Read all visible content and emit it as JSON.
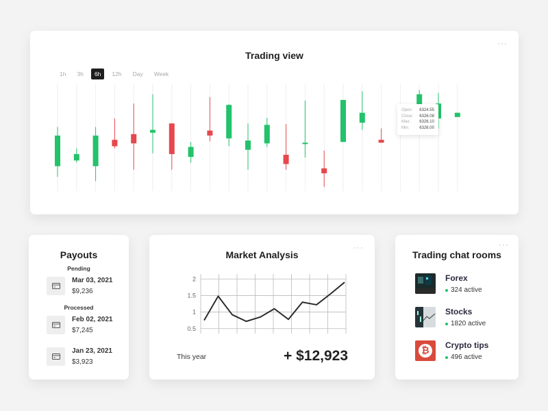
{
  "trading": {
    "title": "Trading view",
    "timeframes": [
      "1h",
      "3h",
      "6h",
      "12h",
      "Day",
      "Week"
    ],
    "active_timeframe": "6h",
    "tooltip": {
      "open_label": "Open:",
      "open": "6324.55",
      "close_label": "Close:",
      "close": "6326.08",
      "max_label": "Max:",
      "max": "6326.10",
      "min_label": "Min:",
      "min": "6326.00"
    },
    "colors": {
      "up": "#23c26b",
      "down": "#e5484d",
      "grid": "#eeeeee"
    },
    "candles": [
      {
        "dir": "up",
        "open": 45,
        "close": 88,
        "high": 100,
        "low": 30
      },
      {
        "dir": "up",
        "open": 53,
        "close": 62,
        "high": 70,
        "low": 50
      },
      {
        "dir": "up",
        "open": 45,
        "close": 88,
        "high": 100,
        "low": 24
      },
      {
        "dir": "down",
        "open": 82,
        "close": 73,
        "high": 112,
        "low": 70
      },
      {
        "dir": "down",
        "open": 90,
        "close": 77,
        "high": 133,
        "low": 40
      },
      {
        "dir": "up",
        "open": 92,
        "close": 96,
        "high": 146,
        "low": 63
      },
      {
        "dir": "down",
        "open": 105,
        "close": 62,
        "high": 105,
        "low": 40
      },
      {
        "dir": "up",
        "open": 58,
        "close": 72,
        "high": 79,
        "low": 50
      },
      {
        "dir": "down",
        "open": 95,
        "close": 88,
        "high": 142,
        "low": 80
      },
      {
        "dir": "up",
        "open": 84,
        "close": 131,
        "high": 132,
        "low": 73
      },
      {
        "dir": "up",
        "open": 68,
        "close": 81,
        "high": 105,
        "low": 40
      },
      {
        "dir": "up",
        "open": 77,
        "close": 103,
        "high": 113,
        "low": 72
      },
      {
        "dir": "down",
        "open": 61,
        "close": 48,
        "high": 104,
        "low": 40
      },
      {
        "dir": "up",
        "open": 76,
        "close": 78,
        "high": 137,
        "low": 57
      },
      {
        "dir": "down",
        "open": 42,
        "close": 35,
        "high": 67,
        "low": 16
      },
      {
        "dir": "up",
        "option": "",
        "open": 79,
        "close": 138,
        "high": 138,
        "low": 79
      },
      {
        "dir": "up",
        "open": 106,
        "close": 120,
        "high": 150,
        "low": 96
      },
      {
        "dir": "down",
        "open": 82,
        "close": 78,
        "high": 98,
        "low": 78
      },
      {
        "dir": "up",
        "open": 110,
        "close": 120,
        "high": 128,
        "low": 100
      },
      {
        "dir": "up",
        "open": 102,
        "close": 146,
        "high": 152,
        "low": 96
      },
      {
        "dir": "up",
        "open": 112,
        "close": 133,
        "high": 148,
        "low": 98
      },
      {
        "dir": "up",
        "open": 114,
        "close": 120,
        "high": 120,
        "low": 114
      }
    ]
  },
  "payouts": {
    "title": "Payouts",
    "pending_label": "Pending",
    "processed_label": "Processed",
    "items": [
      {
        "date": "Mar 03, 2021",
        "amount": "$9,236"
      },
      {
        "date": "Feb 02, 2021",
        "amount": "$7,245"
      },
      {
        "date": "Jan 23, 2021",
        "amount": "$3,923"
      }
    ]
  },
  "market": {
    "title": "Market Analysis",
    "period_label": "This year",
    "value": "+ $12,923",
    "chart_data": {
      "type": "line",
      "y_ticks": [
        "0.5",
        "1",
        "1.5",
        "2"
      ],
      "ylim": [
        0.5,
        2
      ],
      "x": [
        0,
        1,
        2,
        3,
        4,
        5,
        6,
        7,
        8,
        9,
        10
      ],
      "values": [
        0.75,
        1.48,
        0.92,
        0.72,
        0.85,
        1.1,
        0.78,
        1.3,
        1.22,
        1.55,
        1.9
      ]
    }
  },
  "chat": {
    "title": "Trading chat rooms",
    "rooms": [
      {
        "name": "Forex",
        "active": "324 active"
      },
      {
        "name": "Stocks",
        "active": "1820 active"
      },
      {
        "name": "Crypto tips",
        "active": "496 active"
      }
    ]
  }
}
